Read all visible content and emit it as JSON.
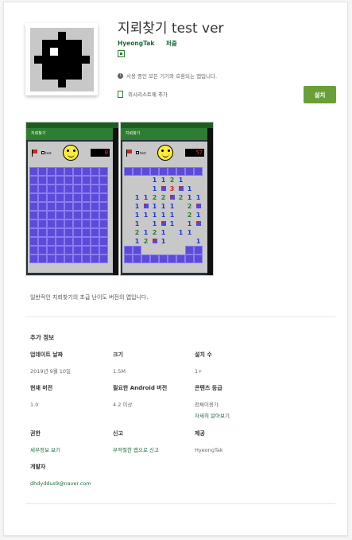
{
  "app": {
    "title": "지뢰찾기 test ver",
    "developer": "HyeongTak",
    "category": "퍼즐",
    "compat_text": "사용 중인 모든 기기와 호환되는 앱입니다.",
    "wishlist_label": "위시리스트에 추가",
    "install_label": "설치",
    "description": "일반적인 지뢰찾기의 초급 난이도 버전의 앱입니다."
  },
  "screenshots": [
    {
      "appbar": "지뢰찾기",
      "check_label": "test",
      "timer": "0"
    },
    {
      "appbar": "지뢰찾기",
      "check_label": "test",
      "timer": "57"
    }
  ],
  "additional_info": {
    "title": "추가 정보",
    "items": [
      {
        "label": "업데이트 날짜",
        "value": "2019년 9월 10일"
      },
      {
        "label": "크기",
        "value": "1.5M"
      },
      {
        "label": "설치 수",
        "value": "1+"
      },
      {
        "label": "현재 버전",
        "value": "1.0"
      },
      {
        "label": "필요한 Android 버전",
        "value": "4.2 이상"
      },
      {
        "label": "콘텐츠 등급",
        "value": "전체이용가",
        "link": "자세히 알아보기"
      },
      {
        "label": "권한",
        "link": "세부정보 보기"
      },
      {
        "label": "신고",
        "link": "부적절한 앱으로 신고"
      },
      {
        "label": "제공",
        "value": "HyeongTak"
      },
      {
        "label": "개발자",
        "link": "dhdyddus9@naver.com"
      }
    ]
  },
  "colors": {
    "accent": "#689f38",
    "link": "#1e6a3f"
  }
}
